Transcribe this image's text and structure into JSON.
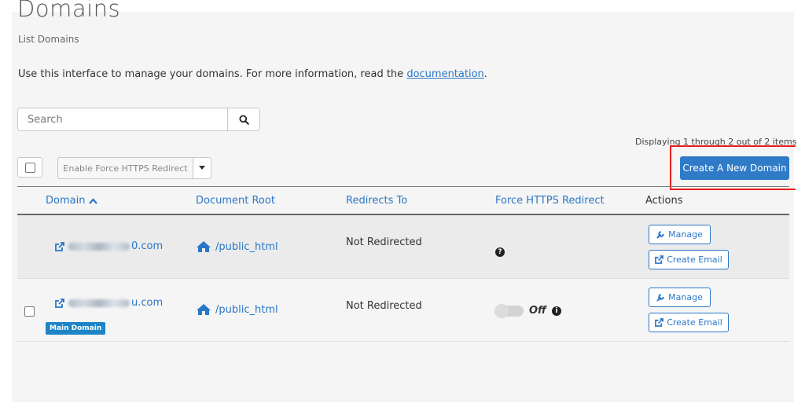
{
  "page": {
    "title": "Domains",
    "subtitle": "List Domains",
    "intro_prefix": "Use this interface to manage your domains. For more information, read the",
    "intro_link": "documentation",
    "intro_suffix": "."
  },
  "search": {
    "placeholder": "Search",
    "button_icon": "search-icon"
  },
  "pagination": {
    "displaying": "Displaying 1 through 2 out of 2 items"
  },
  "toolbar": {
    "bulk_action_label": "Enable Force HTTPS Redirect",
    "create_label": "Create A New Domain"
  },
  "table": {
    "headers": {
      "domain": "Domain",
      "document_root": "Document Root",
      "redirects_to": "Redirects To",
      "force_https": "Force HTTPS Redirect",
      "actions": "Actions"
    },
    "rows": [
      {
        "domain_suffix": "0.com",
        "document_root": "/public_html",
        "redirects_to": "Not Redirected",
        "force_https_icon": "question-circle-icon",
        "manage_label": "Manage",
        "create_email_label": "Create Email"
      },
      {
        "domain_suffix": "u.com",
        "badge": "Main Domain",
        "document_root": "/public_html",
        "redirects_to": "Not Redirected",
        "force_https_state": "Off",
        "manage_label": "Manage",
        "create_email_label": "Create Email"
      }
    ]
  },
  "colors": {
    "accent": "#2f7bc8",
    "link": "#2a77c8",
    "highlight": "#e51d1d",
    "badge": "#1d84c8"
  }
}
